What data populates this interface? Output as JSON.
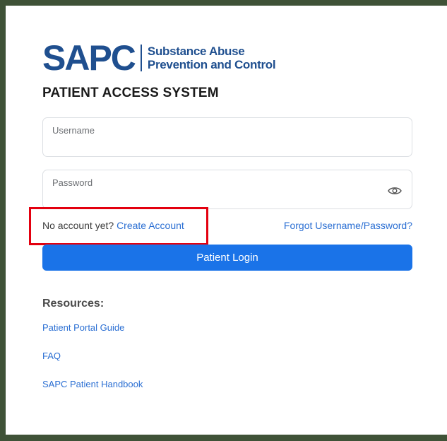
{
  "logo": {
    "mark": "SAPC",
    "line1": "Substance Abuse",
    "line2": "Prevention and Control"
  },
  "title": "PATIENT ACCESS SYSTEM",
  "username": {
    "label": "Username",
    "value": ""
  },
  "password": {
    "label": "Password",
    "value": "",
    "toggle_icon": "eye-icon"
  },
  "account": {
    "prompt": "No account yet?",
    "create_link": "Create Account",
    "forgot_link": "Forgot Username/Password?"
  },
  "login_button": "Patient Login",
  "resources": {
    "heading": "Resources:",
    "links": [
      "Patient Portal Guide",
      "FAQ",
      "SAPC Patient Handbook"
    ]
  },
  "colors": {
    "frame": "#3f5237",
    "brand": "#1f4f8f",
    "link": "#2b6fd3",
    "button": "#1a73e8",
    "highlight": "#e3000f"
  }
}
